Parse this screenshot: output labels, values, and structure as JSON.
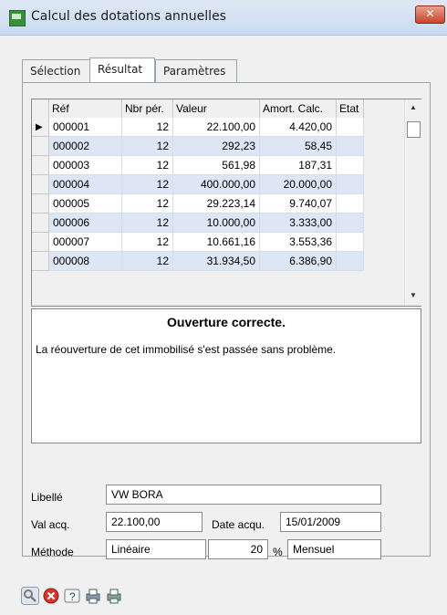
{
  "window": {
    "title": "Calcul des dotations annuelles",
    "close_label": "✕"
  },
  "tabs": [
    {
      "label": "Sélection"
    },
    {
      "label": "Résultat"
    },
    {
      "label": "Paramètres"
    }
  ],
  "grid": {
    "columns": [
      "Réf",
      "Nbr pér.",
      "Valeur",
      "Amort. Calc.",
      "Etat"
    ],
    "rows": [
      [
        "000001",
        "12",
        "22.100,00",
        "4.420,00",
        ""
      ],
      [
        "000002",
        "12",
        "292,23",
        "58,45",
        ""
      ],
      [
        "000003",
        "12",
        "561,98",
        "187,31",
        ""
      ],
      [
        "000004",
        "12",
        "400.000,00",
        "20.000,00",
        ""
      ],
      [
        "000005",
        "12",
        "29.223,14",
        "9.740,07",
        ""
      ],
      [
        "000006",
        "12",
        "10.000,00",
        "3.333,00",
        ""
      ],
      [
        "000007",
        "12",
        "10.661,16",
        "3.553,36",
        ""
      ],
      [
        "000008",
        "12",
        "31.934,50",
        "6.386,90",
        ""
      ]
    ],
    "current_row_marker": "▶"
  },
  "message": {
    "title": "Ouverture correcte.",
    "body": "La réouverture de cet immobilisé s'est passée sans problème."
  },
  "details": {
    "libelle_label": "Libellé",
    "libelle_value": "VW BORA",
    "valacq_label": "Val acq.",
    "valacq_value": "22.100,00",
    "dateacq_label": "Date acqu.",
    "dateacq_value": "15/01/2009",
    "methode_label": "Méthode",
    "methode_value": "Linéaire",
    "taux_value": "20",
    "percent_sign": "%",
    "periodicite_value": "Mensuel"
  },
  "toolbar": {
    "buttons": [
      "search-icon",
      "cancel-icon",
      "help-icon",
      "print-icon",
      "print-preview-icon"
    ]
  }
}
